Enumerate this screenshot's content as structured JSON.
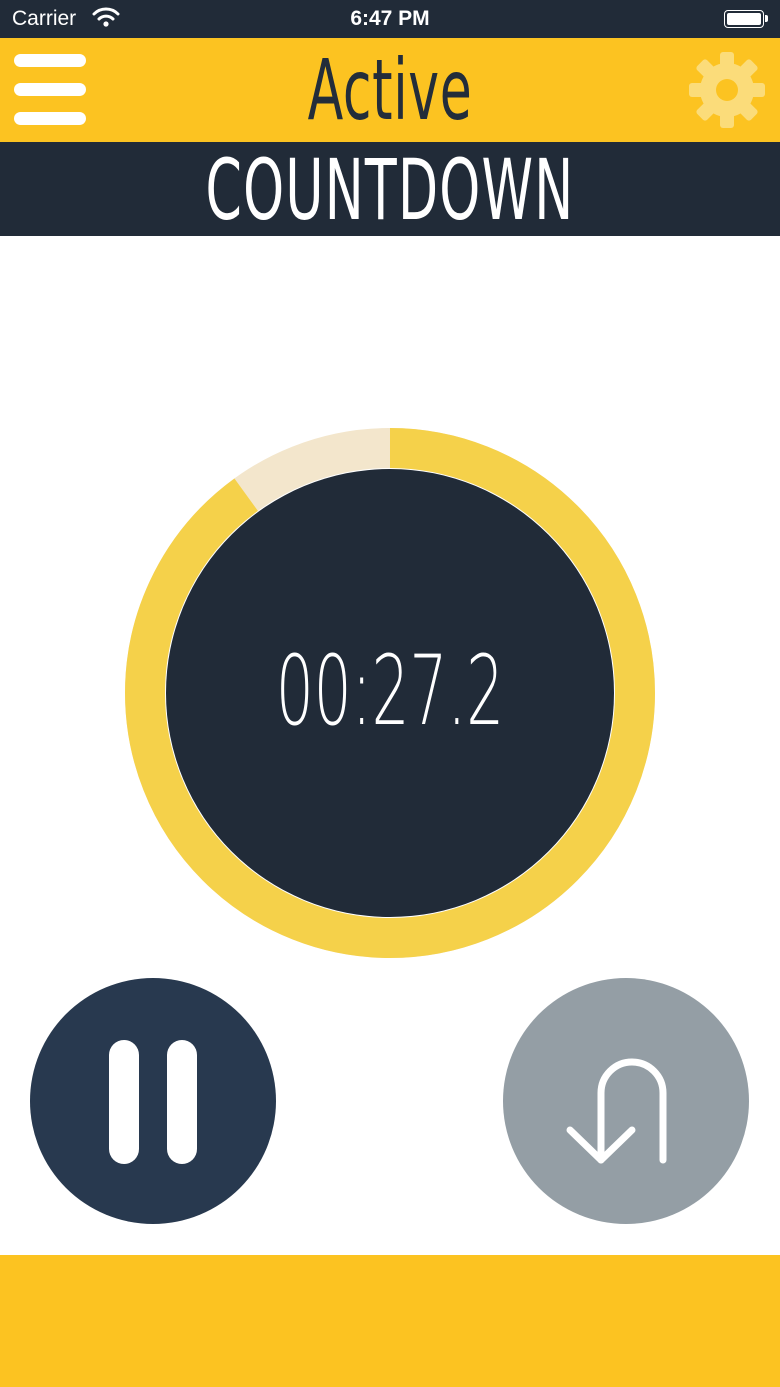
{
  "status_bar": {
    "carrier": "Carrier",
    "time": "6:47 PM",
    "wifi_icon": "wifi-icon",
    "battery_icon": "battery-icon"
  },
  "header": {
    "title": "Active",
    "menu_icon": "hamburger-menu-icon",
    "settings_icon": "gear-icon"
  },
  "subheader": {
    "title": "COUNTDOWN"
  },
  "timer": {
    "display": "00:27.2",
    "progress_remaining_fraction": 0.9
  },
  "controls": {
    "pause_icon": "pause-icon",
    "reset_icon": "u-turn-back-icon"
  },
  "colors": {
    "accent_yellow": "#fcc321",
    "ring_yellow": "#f5d14a",
    "ring_track": "#f3e6cc",
    "dark_navy": "#212b38",
    "pause_button": "#28394f",
    "reset_button": "#949ea5"
  }
}
